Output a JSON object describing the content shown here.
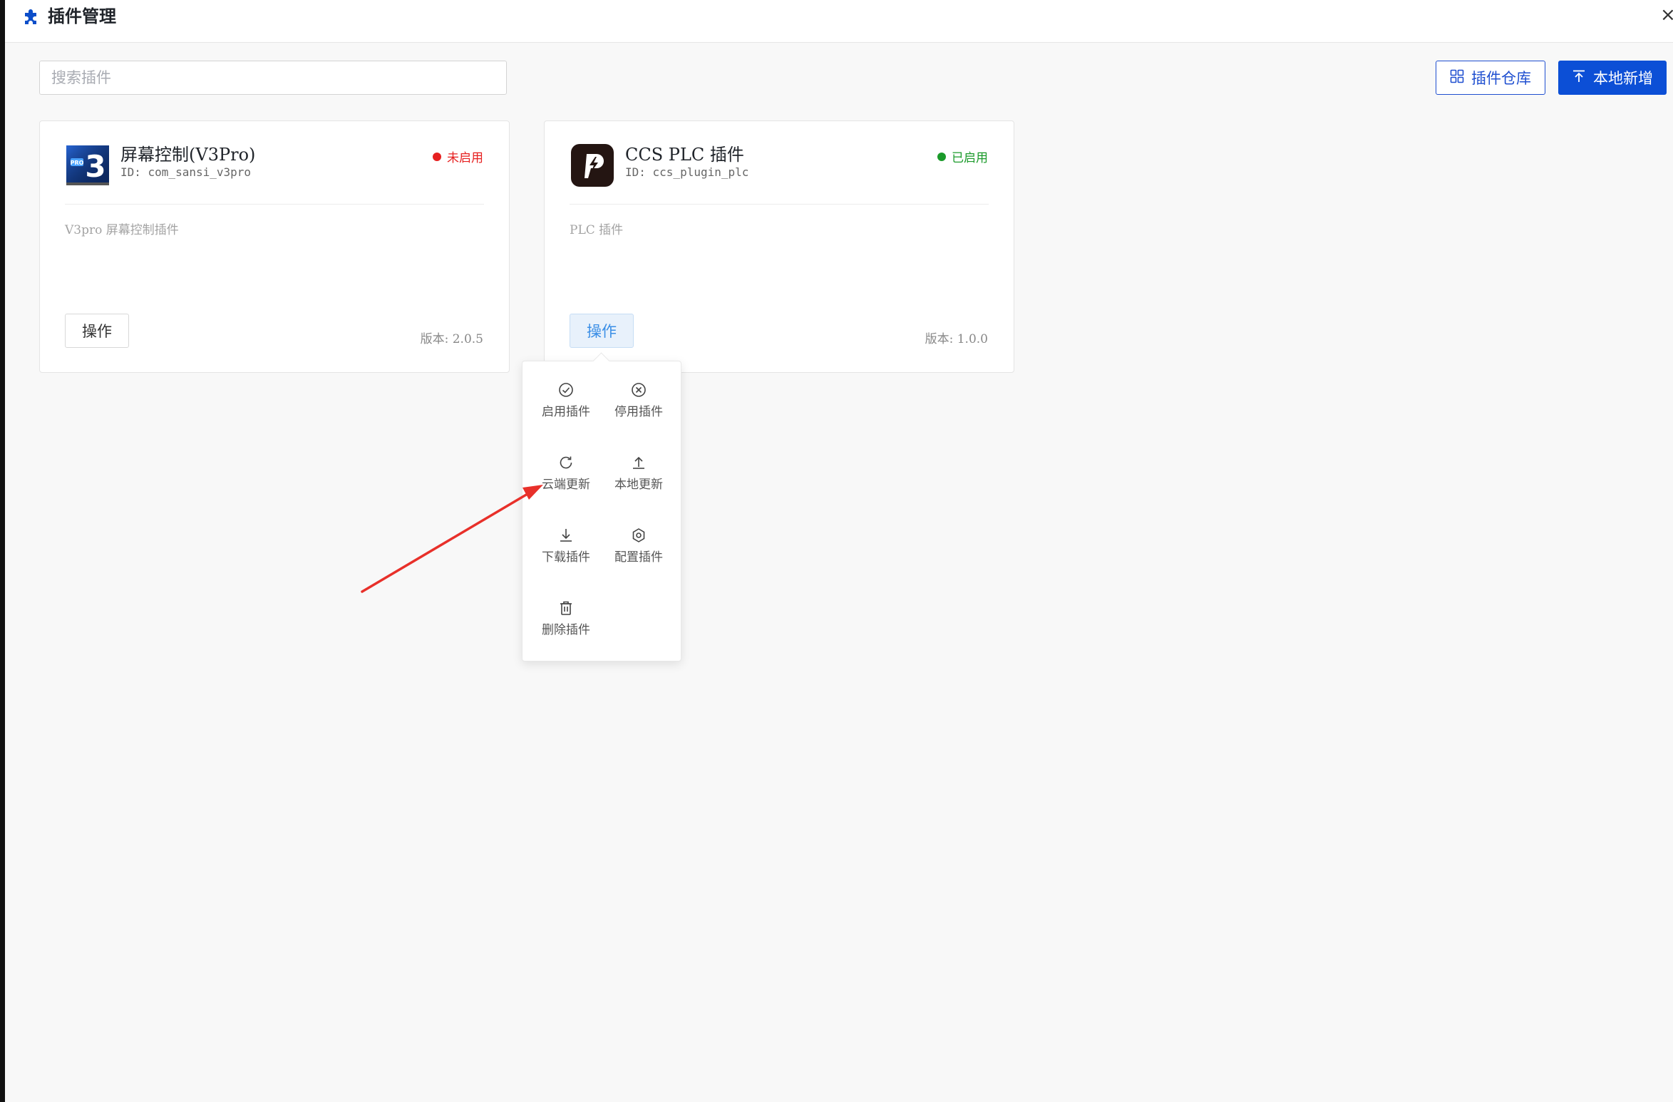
{
  "window": {
    "title": "插件管理",
    "close_glyph": "×"
  },
  "toolbar": {
    "search_placeholder": "搜索插件",
    "repo_label": "插件仓库",
    "local_add_label": "本地新增"
  },
  "plugins": [
    {
      "name": "屏幕控制(V3Pro)",
      "id": "ID: com_sansi_v3pro",
      "status": "未启用",
      "status_color": "#e62020",
      "description": "V3pro 屏幕控制插件",
      "action_label": "操作",
      "version": "版本: 2.0.5",
      "logo_icon": "v3-pro-logo-icon",
      "logo_text": "3",
      "logo_badge": "PRO"
    },
    {
      "name": "CCS PLC 插件",
      "id": "ID: ccs_plugin_plc",
      "status": "已启用",
      "status_color": "#1a9a2a",
      "description": "PLC 插件",
      "action_label": "操作",
      "version": "版本: 1.0.0",
      "logo_icon": "plc-lightning-logo-icon"
    }
  ],
  "action_menu": {
    "items": [
      {
        "label": "启用插件",
        "icon": "check-circle-icon"
      },
      {
        "label": "停用插件",
        "icon": "x-circle-icon"
      },
      {
        "label": "云端更新",
        "icon": "refresh-icon"
      },
      {
        "label": "本地更新",
        "icon": "upload-icon"
      },
      {
        "label": "下载插件",
        "icon": "download-icon"
      },
      {
        "label": "配置插件",
        "icon": "settings-hex-icon"
      },
      {
        "label": "删除插件",
        "icon": "trash-icon"
      }
    ]
  },
  "colors": {
    "primary": "#0c4fd6",
    "annotation_arrow": "#e8302a"
  }
}
